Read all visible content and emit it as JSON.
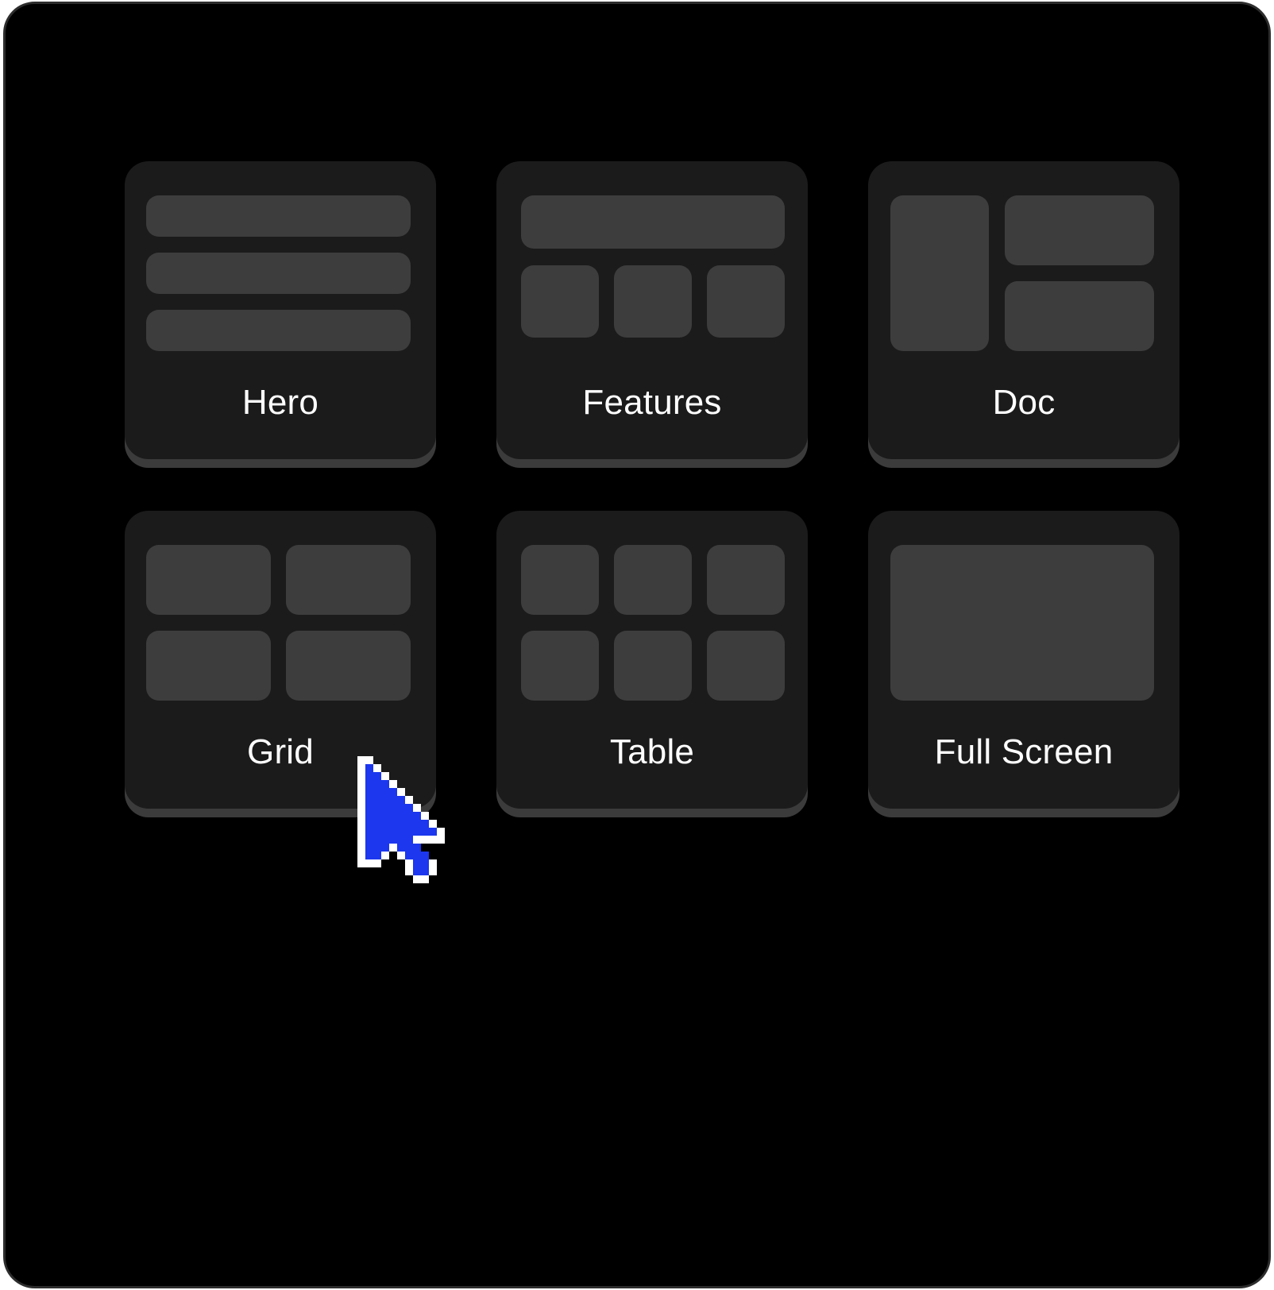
{
  "layouts": [
    {
      "id": "hero",
      "label": "Hero",
      "preview": "three-horizontal-bars"
    },
    {
      "id": "features",
      "label": "Features",
      "preview": "one-bar-over-three-tiles"
    },
    {
      "id": "doc",
      "label": "Doc",
      "preview": "sidebar-with-two-panels"
    },
    {
      "id": "grid",
      "label": "Grid",
      "preview": "two-by-two-tiles"
    },
    {
      "id": "table",
      "label": "Table",
      "preview": "three-by-two-tiles"
    },
    {
      "id": "fullscreen",
      "label": "Full Screen",
      "preview": "single-panel"
    }
  ],
  "cursor": {
    "icon": "pointer-arrow-icon",
    "color": "#1c37ee",
    "hovering": "Grid"
  },
  "colors": {
    "background": "#000000",
    "card": "#1b1b1b",
    "block": "#3d3d3d",
    "text": "#ffffff"
  }
}
